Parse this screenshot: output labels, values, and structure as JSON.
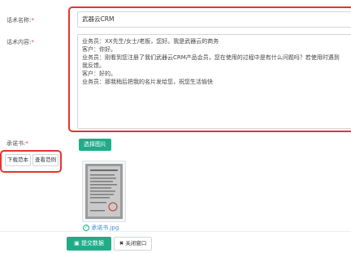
{
  "form": {
    "name_label": "话术名称:",
    "name_required": "*",
    "name_value": "武器云CRM",
    "content_label": "话术内容:",
    "content_required": "*",
    "content_lines": [
      "业务员：XX先生/女士/老板，您好。我是武器云的商务",
      "客户：你好。",
      "业务员：刚看到您注册了我们武器云CRM产品会员，您在使用的过程中是有什么问题吗？若使用时遇到",
      "我反馈。",
      "客户：好的。",
      "业务员：那我稍后把我的名片发给您，祝您生活愉快"
    ],
    "approval_label": "承诺书:",
    "approval_required": "*",
    "select_image_label": "选择图片",
    "download_template_label": "下载范本",
    "view_example_label": "查看范例",
    "file_name": "承诺书.jpg"
  },
  "footer": {
    "submit_label": "提交数据",
    "close_label": "关闭窗口"
  },
  "colors": {
    "accent": "#1fad88",
    "highlight": "#e8322f",
    "required": "#e03c3c"
  }
}
